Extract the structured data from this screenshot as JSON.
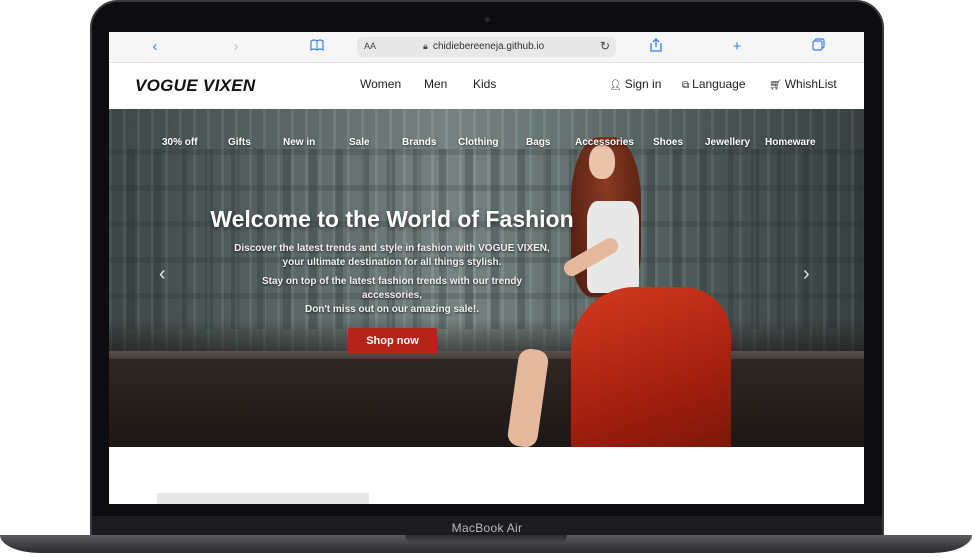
{
  "device": {
    "label": "MacBook Air"
  },
  "browser": {
    "text_size_label": "AA",
    "url": "chidiebereeneja.github.io",
    "icons": [
      "chevron-left-icon",
      "chevron-right-icon",
      "book-icon",
      "lock-icon",
      "reload-icon",
      "share-icon",
      "plus-icon",
      "tabs-icon"
    ]
  },
  "site": {
    "logo": "VOGUE VIXEN",
    "main_nav": [
      "Women",
      "Men",
      "Kids"
    ],
    "utility": {
      "sign_in": "Sign in",
      "language": "Language",
      "wishlist": "WhishList"
    },
    "categories": [
      "30% off",
      "Gifts",
      "New in",
      "Sale",
      "Brands",
      "Clothing",
      "Bags",
      "Accessories",
      "Shoes",
      "Jewellery",
      "Homeware"
    ],
    "hero": {
      "title": "Welcome to the World of Fashion",
      "line1": "Discover the latest trends and style in fashion with VOGUE VIXEN,",
      "line2": "your ultimate destination for all things stylish.",
      "line3": "Stay on top of the latest fashion trends with our trendy",
      "line4": "accessories,",
      "line5": "Don't miss out on our amazing sale!.",
      "cta": "Shop now"
    },
    "colors": {
      "accent": "#b5241a",
      "browser_icon": "#3b82f6"
    }
  }
}
